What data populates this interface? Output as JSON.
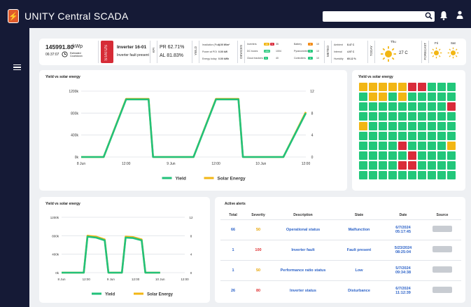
{
  "app": {
    "logo_glyph": "⚡",
    "title": "UNITY Central SCADA"
  },
  "search": {
    "placeholder": ""
  },
  "kpi": {
    "power": "145991.80",
    "power_unit": "kWp",
    "time": "06:37:07",
    "time_note": "Estimated Countdown",
    "status_label": "STATUS",
    "inverter_name": "Inverter 16-01",
    "inverter_state": "Inverter fault present",
    "kpi_label": "KPI",
    "pr": "PR 62.71%",
    "al": "AL 81.83%",
    "yield_label": "YIELD",
    "yield_rows": [
      {
        "label": "Irradiation (Poa)",
        "value": "0.00 W/m²"
      },
      {
        "label": "Power at POI",
        "value": "0.00 kW"
      },
      {
        "label": "Energy today",
        "value": "0.00 kWh"
      }
    ],
    "devices_label": "DEVICES",
    "devices_rows": [
      {
        "label": "Inverters",
        "a": "20",
        "b": "5",
        "c": "35",
        "label2": "Battery",
        "d": "3",
        "e": "10"
      },
      {
        "label": "DC boxes",
        "a": "1000",
        "b": "1004",
        "c": "",
        "label2": "Pyranometers",
        "d": "5",
        "e": "10"
      },
      {
        "label": "Cloud trackers",
        "a": "5",
        "b": "40",
        "c": "",
        "label2": "Controllers",
        "d": "3",
        "e": "10"
      }
    ],
    "meteo_label": "METEO",
    "meteo_rows": [
      {
        "label": "Ambient",
        "value": "8.47 C"
      },
      {
        "label": "Internal",
        "value": "4.97 C"
      },
      {
        "label": "Humidity",
        "value": "60.12 %"
      }
    ],
    "today_label": "TODAY",
    "today_day": "Thu",
    "today_temp": "27 C",
    "forecast_label": "FORECAST",
    "forecast_days": [
      "Fri",
      "Sat"
    ]
  },
  "chart1": {
    "title": "Yield vs solar energy"
  },
  "heatmap": {
    "title": "Yield vs solar energy",
    "colors": {
      "g": "#22c77a",
      "y": "#f2b614",
      "r": "#d92b3a"
    },
    "grid": [
      "yyyyyrrggg",
      "gyygyggggg",
      "gggggggggr",
      "gggggggggg",
      "yggggggggg",
      "gggggggggg",
      "ggggrggggy",
      "gggggrgggg",
      "ggggrrgggg",
      "gggggggggg"
    ]
  },
  "chart3": {
    "title": "Yield vs solar energy"
  },
  "chart_data": [
    {
      "type": "line",
      "title": "Yield vs solar energy",
      "x": [
        "8 Jun",
        "12:00",
        "9 Jun",
        "12:00",
        "10 Jun",
        "12:00"
      ],
      "y_left_ticks": [
        "0k",
        "400k",
        "800k",
        "1200k"
      ],
      "y_right_ticks": [
        "0",
        "4",
        "8",
        "12"
      ],
      "ylim": [
        0,
        1200000
      ],
      "y2lim": [
        0,
        12
      ],
      "series": [
        {
          "name": "Yield",
          "color": "#21c17a",
          "points": [
            [
              0,
              0
            ],
            [
              0.5,
              0
            ],
            [
              1,
              1050000
            ],
            [
              1.5,
              1050000
            ],
            [
              1.6,
              0
            ],
            [
              2.5,
              0
            ],
            [
              3,
              1050000
            ],
            [
              3.5,
              1050000
            ],
            [
              3.6,
              0
            ],
            [
              4.5,
              0
            ],
            [
              5,
              8
            ]
          ]
        },
        {
          "name": "Solar Energy",
          "color": "#f2b614",
          "points": [
            [
              0,
              0
            ],
            [
              0.5,
              0
            ],
            [
              1,
              1060000
            ],
            [
              1.5,
              1060000
            ],
            [
              1.6,
              0
            ],
            [
              2.5,
              0
            ],
            [
              3,
              1060000
            ],
            [
              3.5,
              1060000
            ],
            [
              3.6,
              0
            ],
            [
              4.5,
              0
            ],
            [
              5,
              8.2
            ]
          ]
        }
      ],
      "legend": "bottom"
    },
    {
      "type": "line",
      "title": "Yield vs solar energy",
      "x": [
        "8 Jun",
        "12:00",
        "9 Jun",
        "12:00",
        "10 Jun",
        "12:00"
      ],
      "y_left_ticks": [
        "0k",
        "400k",
        "800k",
        "1200k"
      ],
      "y_right_ticks": [
        "0",
        "4",
        "8",
        "12"
      ],
      "ylim": [
        0,
        1200000
      ],
      "y2lim": [
        0,
        12
      ],
      "series": [
        {
          "name": "Yield",
          "color": "#21c17a",
          "points": [
            [
              0,
              0
            ],
            [
              0.9,
              0
            ],
            [
              1.05,
              780000
            ],
            [
              1.4,
              760000
            ],
            [
              1.75,
              700000
            ],
            [
              1.9,
              0
            ],
            [
              2.45,
              0
            ],
            [
              2.6,
              760000
            ],
            [
              2.9,
              750000
            ],
            [
              3.25,
              700000
            ],
            [
              3.4,
              0
            ],
            [
              4,
              0
            ]
          ]
        },
        {
          "name": "Solar Energy",
          "color": "#f2b614",
          "points": [
            [
              0,
              0
            ],
            [
              0.9,
              0
            ],
            [
              1.05,
              800000
            ],
            [
              1.4,
              780000
            ],
            [
              1.75,
              720000
            ],
            [
              1.9,
              0
            ],
            [
              2.45,
              0
            ],
            [
              2.6,
              780000
            ],
            [
              2.9,
              770000
            ],
            [
              3.25,
              720000
            ],
            [
              3.4,
              0
            ],
            [
              4,
              0
            ]
          ]
        }
      ],
      "legend": "bottom"
    }
  ],
  "alerts": {
    "title": "Active alerts",
    "headers": [
      "Total",
      "Severity",
      "Description",
      "State",
      "Date",
      "Source"
    ],
    "rows": [
      {
        "total": "66",
        "severity": "50",
        "sev_class": "orange",
        "description": "Operational status",
        "state": "Malfunction",
        "date": "6/7/2024",
        "time": "05:17:45"
      },
      {
        "total": "1",
        "severity": "100",
        "sev_class": "red",
        "description": "Inverter fault",
        "state": "Fault present",
        "date": "5/23/2024",
        "time": "08:25:04"
      },
      {
        "total": "1",
        "severity": "50",
        "sev_class": "orange",
        "description": "Performance ratio status",
        "state": "Low",
        "date": "5/7/2024",
        "time": "09:34:38"
      },
      {
        "total": "26",
        "severity": "80",
        "sev_class": "red",
        "description": "Inverter status",
        "state": "Disturbance",
        "date": "6/7/2024",
        "time": "11:12:39"
      }
    ]
  }
}
